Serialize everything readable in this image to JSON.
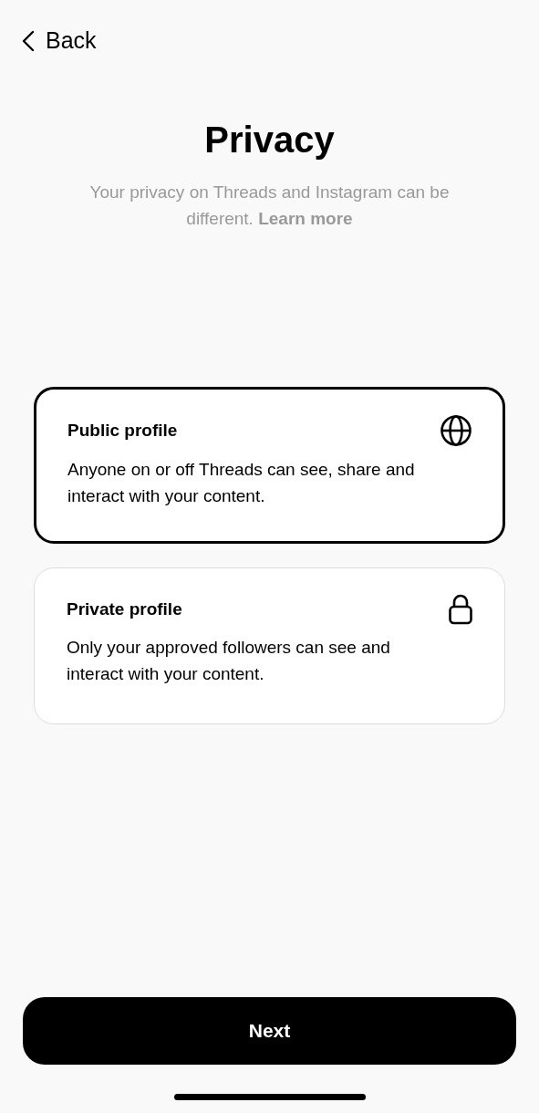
{
  "back": {
    "label": "Back"
  },
  "title": "Privacy",
  "subtitle": {
    "text": "Your privacy on Threads and Instagram can be different.",
    "link": "Learn more"
  },
  "options": [
    {
      "kind": "globe",
      "title": "Public profile",
      "description": "Anyone on or off Threads can see, share and interact with your content.",
      "selected": true
    },
    {
      "kind": "lock",
      "title": "Private profile",
      "description": "Only your approved followers can see and interact with your content.",
      "selected": false
    }
  ],
  "next_button": {
    "label": "Next"
  }
}
